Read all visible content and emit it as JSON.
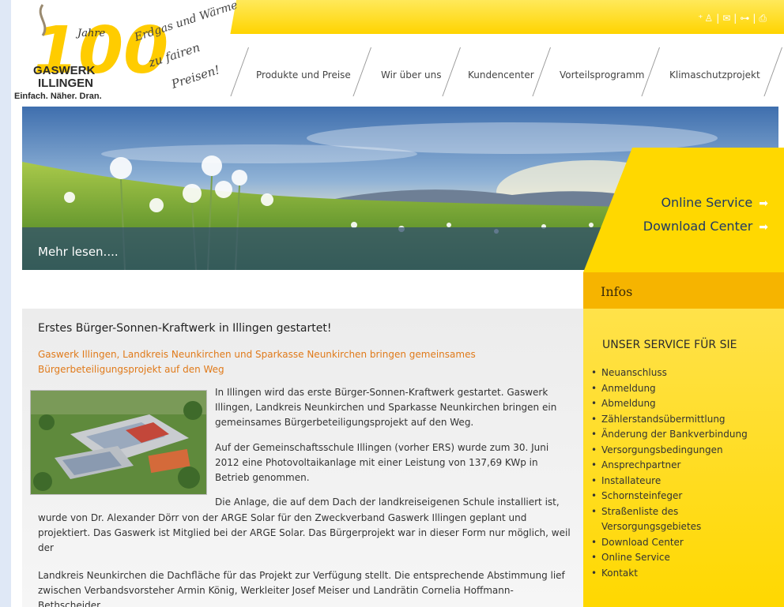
{
  "header": {
    "logo_year": "Jahre",
    "logo_name_1": "GASWERK",
    "logo_name_2": "ILLINGEN",
    "logo_tagline": "Einfach. Näher. Dran.",
    "logo_handwriting": "Erdgas und Wärme zu fairen Preisen!",
    "utility_icons": [
      "accessibility-icon",
      "mail-icon",
      "sitemap-icon",
      "print-icon"
    ]
  },
  "nav": {
    "items": [
      "Produkte und Preise",
      "Wir über uns",
      "Kundencenter",
      "Vorteilsprogramm",
      "Klimaschutzprojekt"
    ]
  },
  "hero": {
    "more_label": "Mehr lesen....",
    "links": [
      {
        "label": "Online Service"
      },
      {
        "label": "Download Center"
      }
    ]
  },
  "sidebar": {
    "infos_label": "Infos",
    "heading": "UNSER SERVICE FÜR SIE",
    "items": [
      "Neuanschluss",
      "Anmeldung",
      "Abmeldung",
      "Zählerstandsübermittlung",
      "Änderung der Bankverbindung",
      "Versorgungsbedingungen",
      "Ansprechpartner",
      "Installateure",
      "Schornsteinfeger",
      "Straßenliste des Versorgungsgebietes",
      "Download Center",
      "Online Service",
      "Kontakt"
    ]
  },
  "article": {
    "title": "Erstes Bürger-Sonnen-Kraftwerk in Illingen gestartet!",
    "subtitle": "Gaswerk Illingen, Landkreis Neunkirchen und Sparkasse Neunkirchen bringen gemeinsames Bürgerbeteiligungsprojekt auf den Weg",
    "para1": "In Illingen wird das erste Bürger-Sonnen-Kraftwerk gestartet. Gaswerk Illingen, Landkreis Neunkirchen und Sparkasse Neunkirchen bringen ein gemeinsames Bürgerbeteiligungsprojekt auf den Weg.",
    "para2": "Auf der Gemeinschaftsschule Illingen (vorher ERS) wurde zum 30. Juni 2012 eine Photovoltaikanlage mit einer Leistung von 137,69 KWp in Betrieb genommen.",
    "para3a": "Die Anlage, die auf dem Dach der landkreiseigenen Schule installiert ist,",
    "para3b": "wurde von Dr. Alexander Dörr von der ARGE Solar für den Zweckverband Gaswerk Illingen geplant und projektiert. Das Gaswerk ist Mitglied bei der ARGE Solar. Das Bürgerprojekt war in dieser Form nur möglich, weil der",
    "para4": "Landkreis Neunkirchen die Dachfläche für das Projekt zur Verfügung stellt. Die entsprechende Abstimmung lief zwischen Verbandsvorsteher Armin König, Werkleiter Josef Meiser und Landrätin Cornelia Hoffmann-Bethscheider."
  },
  "colors": {
    "yellow": "#ffd800",
    "orange_tab": "#f6b400",
    "accent_text": "#e07a1a",
    "link_blue": "#1e3a66"
  }
}
